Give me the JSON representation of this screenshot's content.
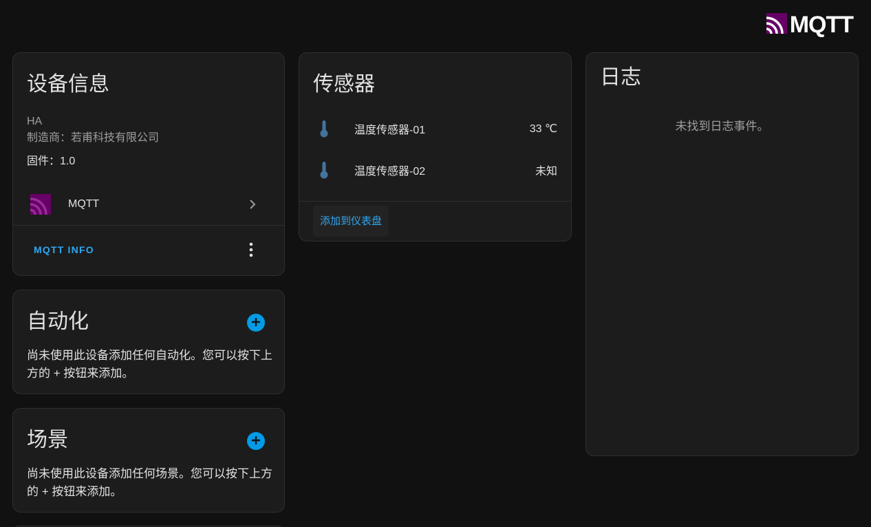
{
  "brand": {
    "text": "MQTT",
    "icon": "mqtt-logo-icon"
  },
  "device_info": {
    "title": "设备信息",
    "model": "HA",
    "manufacturer": "制造商：若甫科技有限公司",
    "firmware": "固件：1.0",
    "integration": {
      "label": "MQTT",
      "icon": "mqtt-logo-icon"
    },
    "mqtt_info_label": "MQTT INFO"
  },
  "automation": {
    "title": "自动化",
    "description": "尚未使用此设备添加任何自动化。您可以按下上方的 + 按钮来添加。"
  },
  "scene": {
    "title": "场景",
    "description": "尚未使用此设备添加任何场景。您可以按下上方的 + 按钮来添加。"
  },
  "sensors": {
    "title": "传感器",
    "items": [
      {
        "name": "温度传感器-01",
        "value": "33 ℃",
        "icon": "thermometer-icon"
      },
      {
        "name": "温度传感器-02",
        "value": "未知",
        "icon": "thermometer-icon"
      }
    ],
    "add_to_dashboard": "添加到仪表盘"
  },
  "logbook": {
    "title": "日志",
    "empty_text": "未找到日志事件。"
  },
  "colors": {
    "background": "#111111",
    "card": "#1c1c1c",
    "accent": "#2ea7f2",
    "fab": "#039be5",
    "mqtt_purple": "#660066"
  }
}
